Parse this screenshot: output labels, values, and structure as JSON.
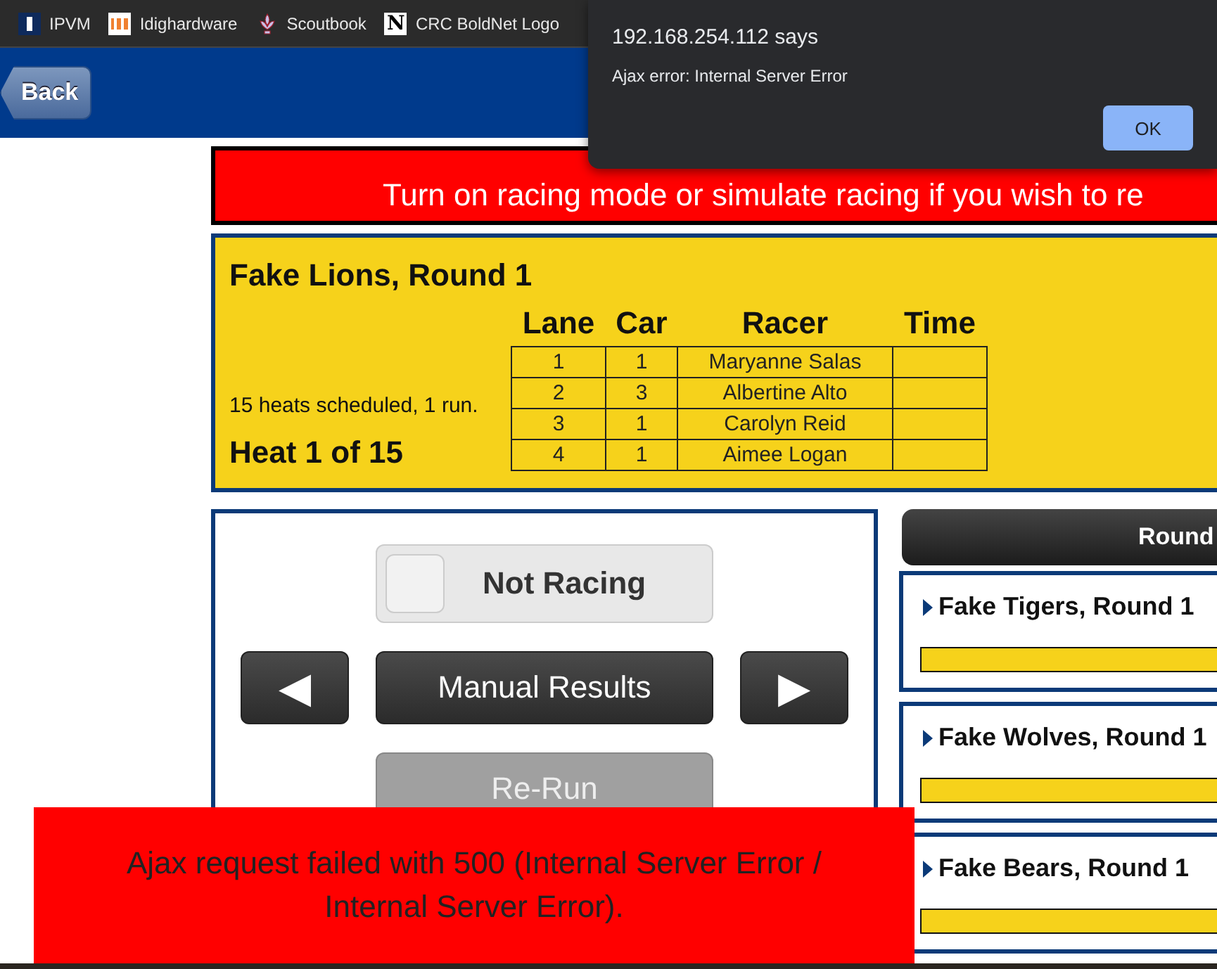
{
  "bookmarks": [
    {
      "kind": "ipvm",
      "label": "IPVM"
    },
    {
      "kind": "idh",
      "label": "Idighardware"
    },
    {
      "kind": "scout",
      "label": "Scoutbook"
    },
    {
      "kind": "n",
      "label": "CRC BoldNet Logo",
      "icon_text": "N"
    }
  ],
  "header": {
    "back_button": "Back"
  },
  "banner": "Turn on racing mode or simulate racing if you wish to re",
  "heat": {
    "title": "Fake Lions, Round 1",
    "scheduled": "15 heats scheduled, 1 run.",
    "heat_label": "Heat 1 of 15",
    "columns": [
      "Lane",
      "Car",
      "Racer",
      "Time"
    ],
    "rows": [
      [
        "1",
        "1",
        "Maryanne Salas",
        ""
      ],
      [
        "2",
        "3",
        "Albertine Alto",
        ""
      ],
      [
        "3",
        "1",
        "Carolyn Reid",
        ""
      ],
      [
        "4",
        "1",
        "Aimee Logan",
        ""
      ]
    ]
  },
  "controls": {
    "racing_toggle": {
      "label": "Not Racing",
      "on": false
    },
    "prev": "◀",
    "manual": "Manual Results",
    "next": "▶",
    "rerun": {
      "label": "Re-Run",
      "disabled": true
    }
  },
  "rounds": {
    "header": "Round",
    "items": [
      {
        "title": "Fake Tigers, Round 1",
        "level": 1
      },
      {
        "title": "Fake Wolves, Round 1",
        "level": 1
      },
      {
        "title": "Fake Bears, Round 1",
        "level": 1
      }
    ]
  },
  "dialog": {
    "title": "192.168.254.112 says",
    "message": "Ajax error: Internal Server Error",
    "ok": "OK"
  },
  "toast": "Ajax request failed with 500 (Internal Server Error / Internal Server Error)."
}
